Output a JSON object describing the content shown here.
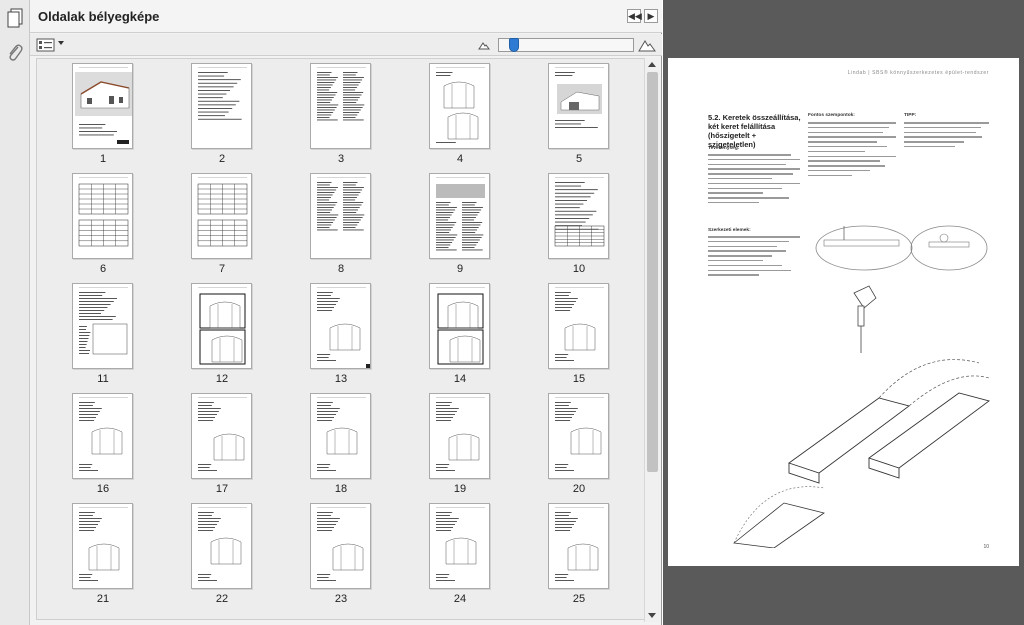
{
  "panel": {
    "title": "Oldalak bélyegképe",
    "collapse_label": "◀◀",
    "expand_label": "▶"
  },
  "toolbar": {
    "options_icon": "thumbnail-options-icon",
    "zoom_small_icon": "mountain-small-icon",
    "zoom_large_icon": "mountain-large-icon",
    "zoom_level": 0.08
  },
  "thumbnails": [
    {
      "number": "1"
    },
    {
      "number": "2"
    },
    {
      "number": "3"
    },
    {
      "number": "4"
    },
    {
      "number": "5"
    },
    {
      "number": "6"
    },
    {
      "number": "7"
    },
    {
      "number": "8"
    },
    {
      "number": "9"
    },
    {
      "number": "10"
    },
    {
      "number": "11"
    },
    {
      "number": "12"
    },
    {
      "number": "13"
    },
    {
      "number": "14"
    },
    {
      "number": "15"
    },
    {
      "number": "16"
    },
    {
      "number": "17"
    },
    {
      "number": "18"
    },
    {
      "number": "19"
    },
    {
      "number": "20"
    },
    {
      "number": "21"
    },
    {
      "number": "22"
    },
    {
      "number": "23"
    },
    {
      "number": "24"
    },
    {
      "number": "25"
    }
  ],
  "document": {
    "running_head": "Lindab | SBS® könnyűszerkezetes épület-rendszer",
    "heading": "5.2. Keretek összeállítása, két keret felállítása (hőszigetelt + szigeteletlen)",
    "sub_activity": "Tevékenység:",
    "sub_parts": "Szerkezeti elemek:",
    "sub_notes": "Fontos szempontok:",
    "sub_tip": "TIPP:",
    "page_number": "10"
  },
  "colors": {
    "accent": "#2f7bd3",
    "doc_background": "#5a5a5a",
    "panel_background": "#ededed"
  }
}
